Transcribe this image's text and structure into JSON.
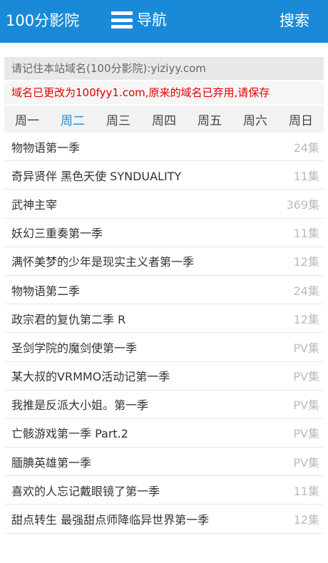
{
  "header": {
    "site_title": "100分影院",
    "nav_label": "导航",
    "search_label": "搜索"
  },
  "notice": {
    "domain_hint": "请记住本站域名(100分影院):yiziyy.com",
    "domain_changed": "域名已更改为100fyy1.com,原来的域名已弃用,请保存"
  },
  "weekdays": [
    "周一",
    "周二",
    "周三",
    "周四",
    "周五",
    "周六",
    "周日"
  ],
  "active_weekday_index": 1,
  "colors": {
    "header_bg": "#1a8ad8",
    "accent": "#1a8ad8",
    "alert_text": "#e00000",
    "episode_text": "#bbbbbb"
  },
  "list": [
    {
      "title": "物物语第一季",
      "episodes": "24集"
    },
    {
      "title": "奇异贤伴 黑色天使 SYNDUALITY",
      "episodes": "11集"
    },
    {
      "title": "武神主宰",
      "episodes": "369集"
    },
    {
      "title": "妖幻三重奏第一季",
      "episodes": "11集"
    },
    {
      "title": "满怀美梦的少年是现实主义者第一季",
      "episodes": "12集"
    },
    {
      "title": "物物语第二季",
      "episodes": "24集"
    },
    {
      "title": "政宗君的复仇第二季 R",
      "episodes": "12集"
    },
    {
      "title": "圣剑学院的魔剑使第一季",
      "episodes": "PV集"
    },
    {
      "title": "某大叔的VRMMO活动记第一季",
      "episodes": "PV集"
    },
    {
      "title": "我推是反派大小姐。第一季",
      "episodes": "PV集"
    },
    {
      "title": "亡骸游戏第一季 Part.2",
      "episodes": "PV集"
    },
    {
      "title": "腼腆英雄第一季",
      "episodes": "PV集"
    },
    {
      "title": "喜欢的人忘记戴眼镜了第一季",
      "episodes": "11集"
    },
    {
      "title": "甜点转生 最强甜点师降临异世界第一季",
      "episodes": "12集"
    }
  ]
}
